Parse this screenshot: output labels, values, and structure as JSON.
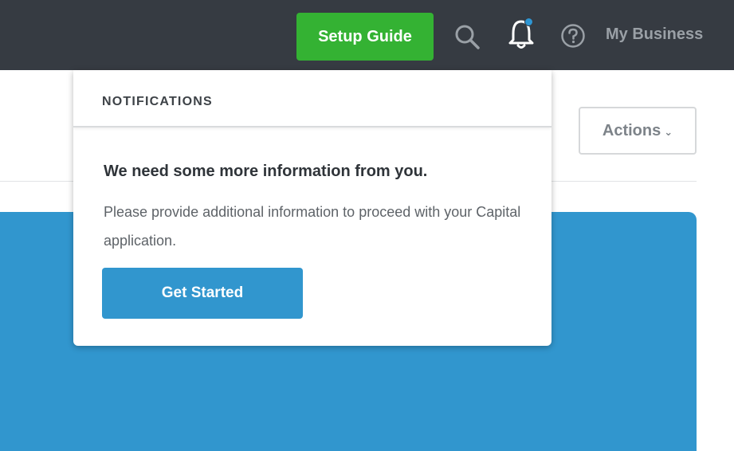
{
  "header": {
    "setup_guide_label": "Setup Guide",
    "business_name": "My Business",
    "icons": [
      "search-icon",
      "bell-icon",
      "help-icon"
    ],
    "has_unread_notification": true
  },
  "toolbar": {
    "actions_label": "Actions"
  },
  "notifications": {
    "title": "NOTIFICATIONS",
    "items": [
      {
        "headline": "We need some more information from you.",
        "body": "Please provide additional information to proceed with your Capital application.",
        "cta_label": "Get Started"
      }
    ]
  },
  "colors": {
    "topbar_bg": "#363b42",
    "setup_green": "#34b233",
    "accent_blue": "#3196ce",
    "notification_dot": "#2e96d3"
  }
}
